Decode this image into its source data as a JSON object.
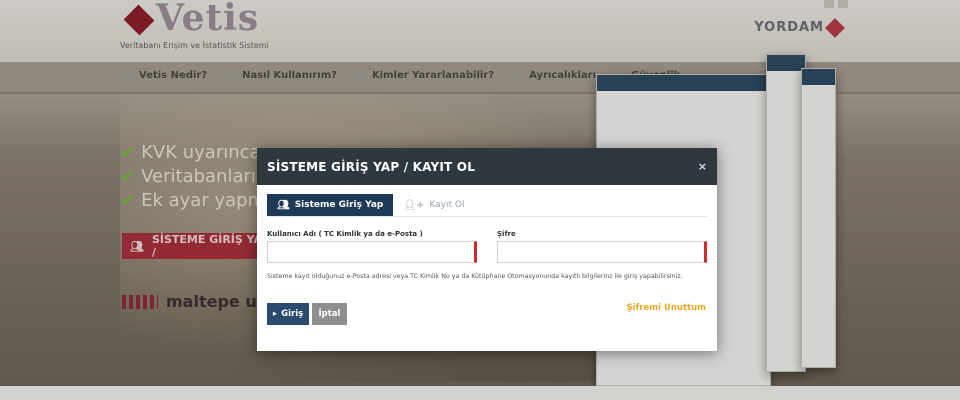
{
  "site": {
    "logo_text": "Vetis",
    "logo_subtitle": "Veritabanı Erişim ve İstatistik Sistemi",
    "partner_logo_text": "YORDAM"
  },
  "nav": {
    "items": [
      {
        "label": "Vetis Nedir?"
      },
      {
        "label": "Nasıl Kullanırım?"
      },
      {
        "label": "Kimler Yararlanabilir?"
      },
      {
        "label": "Ayrıcalıkları"
      },
      {
        "label": "Güvenlik"
      }
    ]
  },
  "hero": {
    "lines": [
      {
        "text": "KVK uyarınca g"
      },
      {
        "text": "Veritabanların"
      },
      {
        "text": "Ek ayar yapma"
      }
    ],
    "cta_label": "SİSTEME GİRİŞ YAP /",
    "institution_text": "maltepe unive"
  },
  "modal": {
    "title": "SİSTEME GİRİŞ YAP / KAYIT OL",
    "close_symbol": "×",
    "tabs": [
      {
        "label": "Sisteme Giriş Yap",
        "active": true
      },
      {
        "label": "Kayıt Ol",
        "active": false
      }
    ],
    "username": {
      "label": "Kullanıcı Adı ( TC Kimlik ya da e-Posta )",
      "value": "",
      "placeholder": ""
    },
    "password": {
      "label": "Şifre",
      "value": "",
      "placeholder": ""
    },
    "hint": "Sisteme kayıt olduğunuz e-Posta adresi veya TC Kimlik No ya da Kütüphane Otomasyonunda kayıtlı bilgilerinz ile giriş yapabilirsiniz.",
    "login_button": "Giriş",
    "cancel_button": "İptal",
    "forgot_link": "Şifremi Unuttum"
  },
  "colors": {
    "modal_header": "#30383f",
    "active_tab": "#1f3a57",
    "login_button": "#2a4b6e",
    "cancel_button": "#8e8e8e",
    "forgot_link": "#e8a726",
    "required_marker": "#d12a2a"
  }
}
